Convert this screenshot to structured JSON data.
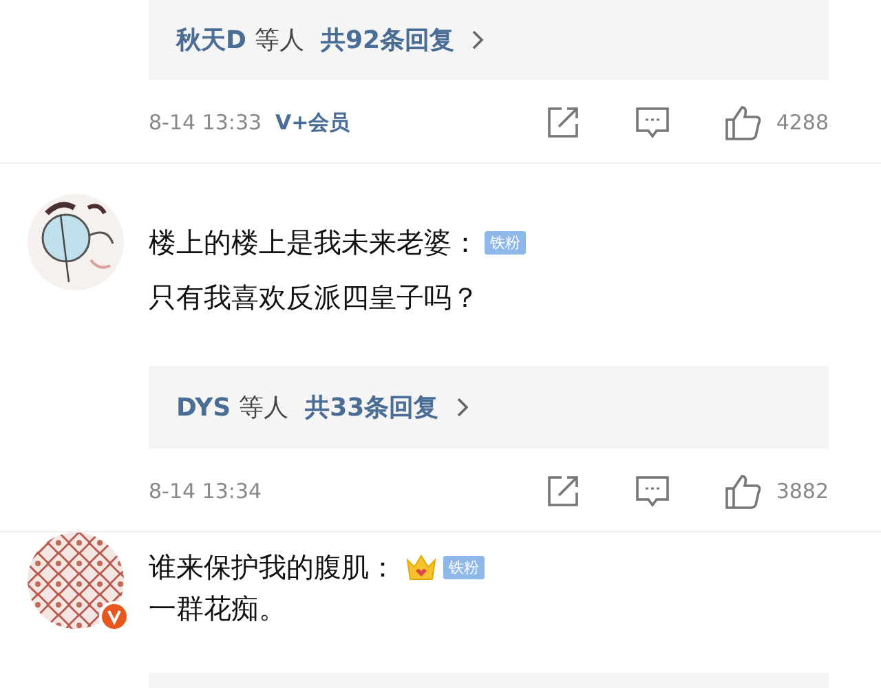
{
  "threads": [
    {
      "replies": {
        "names": "秋天D",
        "suffix": "等人",
        "total": "共92条回复"
      },
      "time": "8-14 13:33",
      "member_badge": "V+会员",
      "likes": "4288"
    },
    {
      "avatar": {
        "kind": "glasses",
        "verified": false
      },
      "author": "楼上的楼上是我未来老婆：",
      "crown": false,
      "fan_badge": "铁粉",
      "text": "只有我喜欢反派四皇子吗？",
      "replies": {
        "names": "DYS",
        "suffix": "等人",
        "total": "共33条回复"
      },
      "time": "8-14 13:34",
      "likes": "3882"
    },
    {
      "avatar": {
        "kind": "pattern",
        "verified": true
      },
      "author": "谁来保护我的腹肌：",
      "crown": true,
      "fan_badge": "铁粉",
      "text": "一群花痴。",
      "reply_box_cut": true
    }
  ]
}
